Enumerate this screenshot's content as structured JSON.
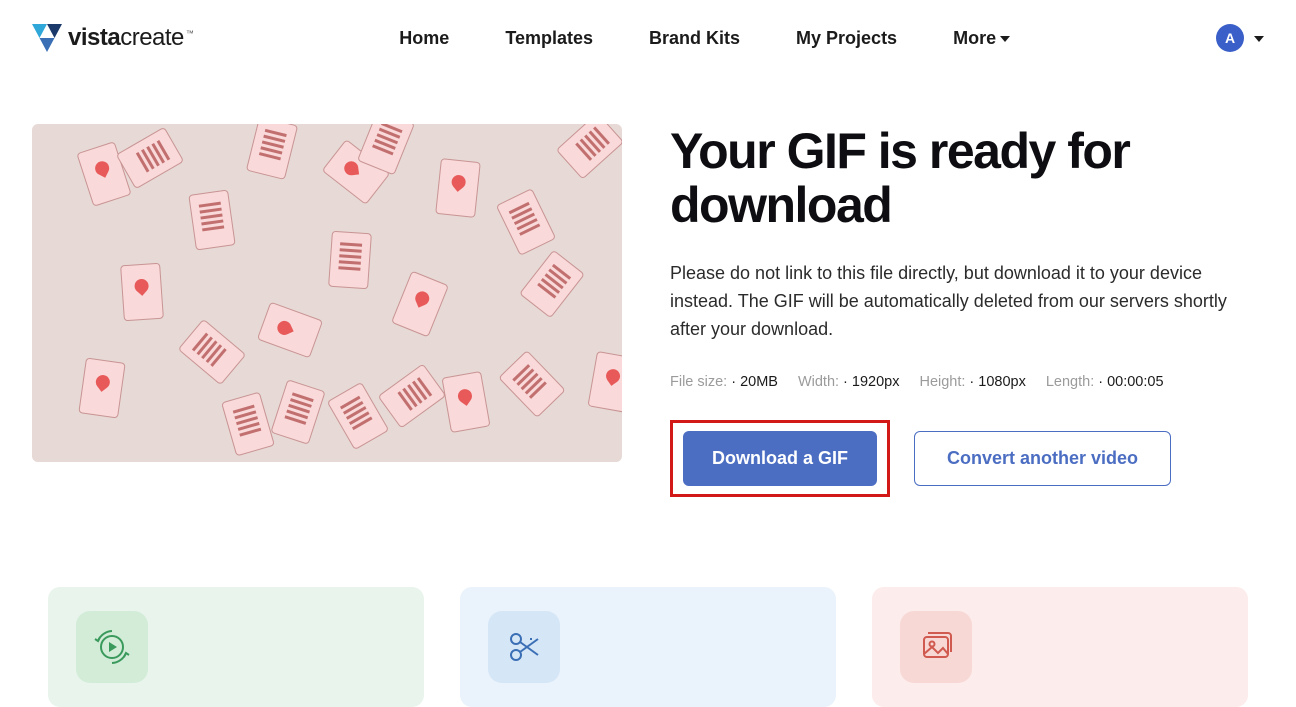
{
  "brand": {
    "name_bold": "vista",
    "name_light": "create",
    "tm": "™"
  },
  "nav": {
    "items": [
      {
        "label": "Home"
      },
      {
        "label": "Templates"
      },
      {
        "label": "Brand Kits"
      },
      {
        "label": "My Projects"
      },
      {
        "label": "More"
      }
    ]
  },
  "account": {
    "initial": "A"
  },
  "main": {
    "title": "Your GIF is ready for download",
    "description": "Please do not link to this file directly, but download it to your device instead. The GIF will be automatically deleted from our servers shortly after your download.",
    "meta": {
      "filesize_label": "File size:",
      "filesize_value": "20MB",
      "width_label": "Width:",
      "width_value": "1920px",
      "height_label": "Height:",
      "height_value": "1080px",
      "length_label": "Length:",
      "length_value": "00:00:05"
    },
    "buttons": {
      "download": "Download a GIF",
      "convert": "Convert another video"
    }
  },
  "cards": {
    "icons": [
      "replay-icon",
      "cut-icon",
      "image-icon"
    ]
  }
}
